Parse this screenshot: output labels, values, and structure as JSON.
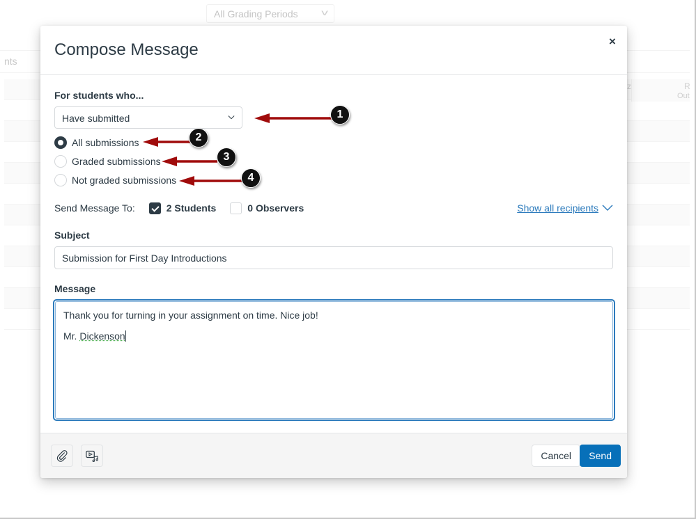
{
  "background": {
    "grading_period_select": "All Grading Periods",
    "tab_partial_text": "nts",
    "column_header_partial_1": "z",
    "column_header_partial_2": "R",
    "column_header_partial_3": "Out"
  },
  "modal": {
    "title": "Compose Message",
    "close_label": "×",
    "criteria_label": "For students who...",
    "criteria_select_value": "Have submitted",
    "radio_options": [
      {
        "label": "All submissions",
        "checked": true
      },
      {
        "label": "Graded submissions",
        "checked": false
      },
      {
        "label": "Not graded submissions",
        "checked": false
      }
    ],
    "send_to_label": "Send Message To:",
    "recipients": [
      {
        "label": "2 Students",
        "checked": true
      },
      {
        "label": "0 Observers",
        "checked": false
      }
    ],
    "show_all_recipients": "Show all recipients",
    "subject_label": "Subject",
    "subject_value": "Submission for First Day Introductions",
    "message_label": "Message",
    "message_lines": [
      "Thank you for turning in your assignment on time. Nice job!",
      "Mr. ",
      "Dickenson"
    ],
    "footer": {
      "attach_icon": "paperclip-icon",
      "media_icon": "media-icon",
      "cancel_label": "Cancel",
      "send_label": "Send"
    }
  },
  "callouts": [
    "1",
    "2",
    "3",
    "4"
  ],
  "colors": {
    "primary": "#0770b9",
    "link": "#2b7abc",
    "text": "#2d3b45",
    "callout_arrow": "#a00b0b"
  }
}
